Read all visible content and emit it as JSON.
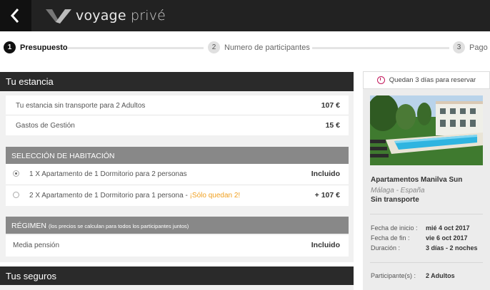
{
  "header": {
    "logo_main": "voyage",
    "logo_accent": "privé"
  },
  "steps": [
    {
      "num": "1",
      "label": "Presupuesto"
    },
    {
      "num": "2",
      "label": "Numero de participantes"
    },
    {
      "num": "3",
      "label": "Pago"
    }
  ],
  "stay": {
    "title": "Tu estancia",
    "rows": [
      {
        "label": "Tu estancia sin transporte para 2 Adultos",
        "value": "107 €"
      },
      {
        "label": "Gastos de Gestión",
        "value": "15 €"
      }
    ]
  },
  "rooms": {
    "title": "SELECCIÓN DE HABITACIÓN",
    "options": [
      {
        "label": "1 X Apartamento de 1 Dormitorio para 2 personas",
        "warning": "",
        "value": "Incluido",
        "selected": true
      },
      {
        "label": "2 X Apartamento de 1 Dormitorio para 1 persona - ",
        "warning": "¡Sólo quedan 2!",
        "value": "+ 107 €",
        "selected": false
      }
    ]
  },
  "regime": {
    "title": "RÉGIMEN",
    "note": "(los precios se calculan para todos los participantes juntos)",
    "label": "Media pensión",
    "value": "Incluido"
  },
  "insurance": {
    "title": "Tus seguros"
  },
  "sidebar": {
    "countdown": "Quedan 3 días para reservar",
    "hotel_name": "Apartamentos Manilva Sun",
    "location": "Málaga - España",
    "transport": "Sin transporte",
    "details": [
      {
        "label": "Fecha de inicio :",
        "value": "mié 4 oct 2017"
      },
      {
        "label": "Fecha de fin :",
        "value": "vie 6 oct 2017"
      },
      {
        "label": "Duración :",
        "value": "3 días - 2 noches"
      }
    ],
    "participants_label": "Participante(s) :",
    "participants_value": "2 Adultos"
  }
}
